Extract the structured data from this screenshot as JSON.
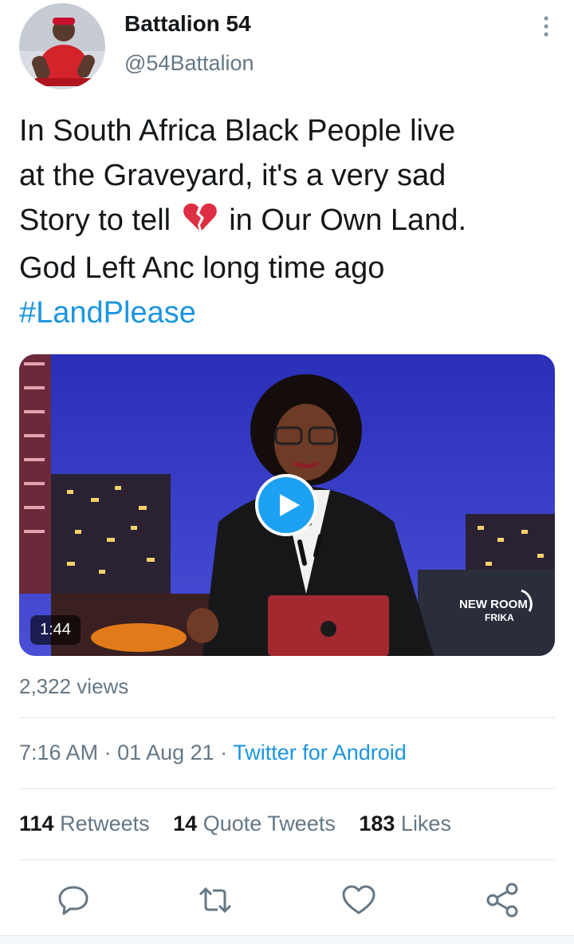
{
  "author": {
    "display_name": "Battalion 54",
    "handle": "@54Battalion"
  },
  "tweet": {
    "line1": "In South Africa Black People live",
    "line2": "at the Graveyard, it's a very sad",
    "line3_before": "Story to tell",
    "line3_after": "in Our Own Land.",
    "line4": "God Left Anc long time ago",
    "hashtag": "#LandPlease",
    "emoji": "broken-heart-icon"
  },
  "media": {
    "duration": "1:44",
    "views": "2,322 views",
    "logo": {
      "line1": "NEW ROOM",
      "line2": "FRIKA"
    }
  },
  "meta": {
    "time": "7:16 AM",
    "separator1": " · ",
    "date": "01 Aug 21",
    "separator2": " · ",
    "source": "Twitter for Android"
  },
  "stats": {
    "retweets_count": "114",
    "retweets_label": "Retweets",
    "quotes_count": "14",
    "quotes_label": "Quote Tweets",
    "likes_count": "183",
    "likes_label": "Likes"
  },
  "colors": {
    "link": "#1b95e0",
    "secondary": "#657786",
    "primary_text": "#14171a"
  },
  "icons": [
    "reply-icon",
    "retweet-icon",
    "like-icon",
    "share-icon",
    "more-vertical-icon",
    "play-icon"
  ]
}
